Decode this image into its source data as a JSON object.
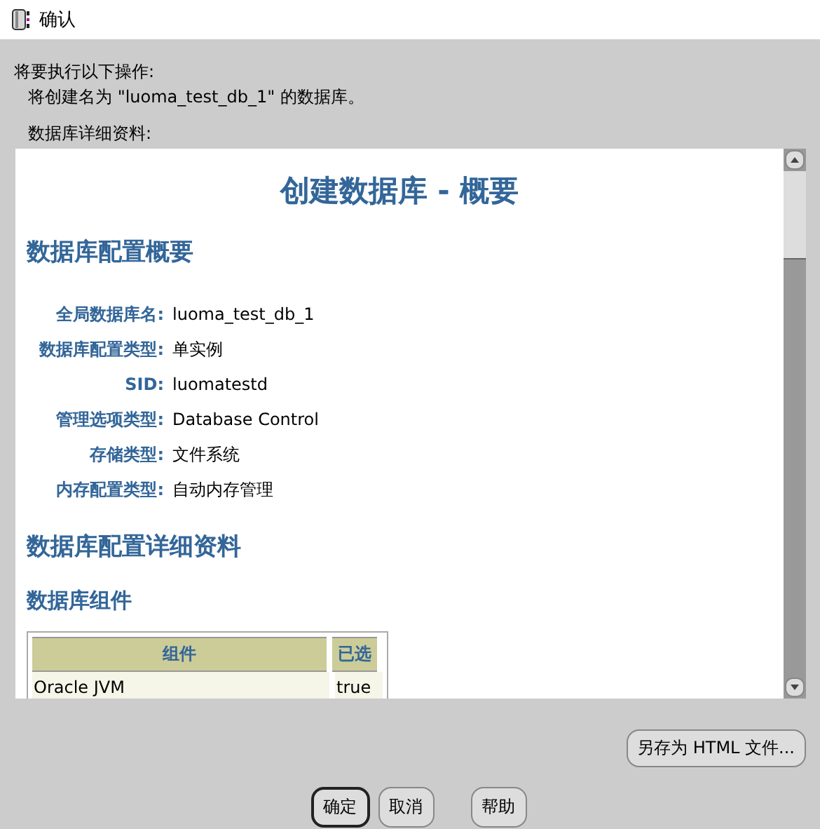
{
  "window": {
    "title": "确认"
  },
  "intro": "将要执行以下操作:",
  "action": "将创建名为 \"luoma_test_db_1\" 的数据库。",
  "details_label": "数据库详细资料:",
  "summary": {
    "title": "创建数据库 - 概要",
    "section": "数据库配置概要",
    "fields": [
      {
        "label": "全局数据库名:",
        "value": "luoma_test_db_1"
      },
      {
        "label": "数据库配置类型:",
        "value": "单实例"
      },
      {
        "label": "SID:",
        "value": "luomatestd"
      },
      {
        "label": "管理选项类型:",
        "value": "Database Control"
      },
      {
        "label": "存储类型:",
        "value": "文件系统"
      },
      {
        "label": "内存配置类型:",
        "value": "自动内存管理"
      }
    ],
    "details_section": "数据库配置详细资料",
    "components_section": "数据库组件",
    "table": {
      "columns": [
        "组件",
        "已选"
      ],
      "rows": [
        [
          "Oracle JVM",
          "true"
        ]
      ]
    }
  },
  "save_button": "另存为 HTML 文件...",
  "buttons": [
    {
      "label": "确定",
      "default": true
    },
    {
      "label": "取消",
      "default": false
    },
    {
      "label": "帮助",
      "default": false
    }
  ]
}
